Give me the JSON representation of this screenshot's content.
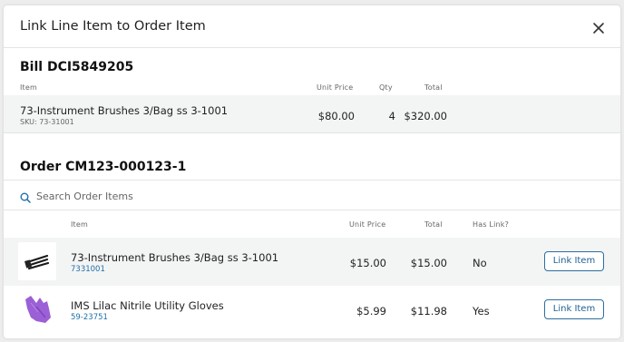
{
  "modal": {
    "title": "Link Line Item to Order Item"
  },
  "bill": {
    "heading": "Bill DCI5849205",
    "columns": {
      "item": "Item",
      "unit_price": "Unit Price",
      "qty": "Qty",
      "total": "Total"
    },
    "row": {
      "name": "73-Instrument Brushes 3/Bag ss 3-1001",
      "sku": "SKU: 73-31001",
      "unit_price": "$80.00",
      "qty": "4",
      "total": "$320.00"
    }
  },
  "order": {
    "heading": "Order CM123-000123-1",
    "search": {
      "placeholder": "Search Order Items"
    },
    "columns": {
      "item": "Item",
      "unit_price": "Unit Price",
      "total": "Total",
      "has_link": "Has Link?"
    },
    "rows": [
      {
        "name": "73-Instrument Brushes 3/Bag ss 3-1001",
        "sku": "7331001",
        "unit_price": "$15.00",
        "total": "$15.00",
        "has_link": "No",
        "button": "Link Item",
        "thumb_icon": "brush-product-image"
      },
      {
        "name": "IMS Lilac Nitrile Utility Gloves",
        "sku": "59-23751",
        "unit_price": "$5.99",
        "total": "$11.98",
        "has_link": "Yes",
        "button": "Link Item",
        "thumb_icon": "glove-product-image"
      }
    ]
  },
  "colors": {
    "accent": "#1f6fa8",
    "row_shade": "#f3f4f4",
    "glove": "#9b5fd6"
  }
}
